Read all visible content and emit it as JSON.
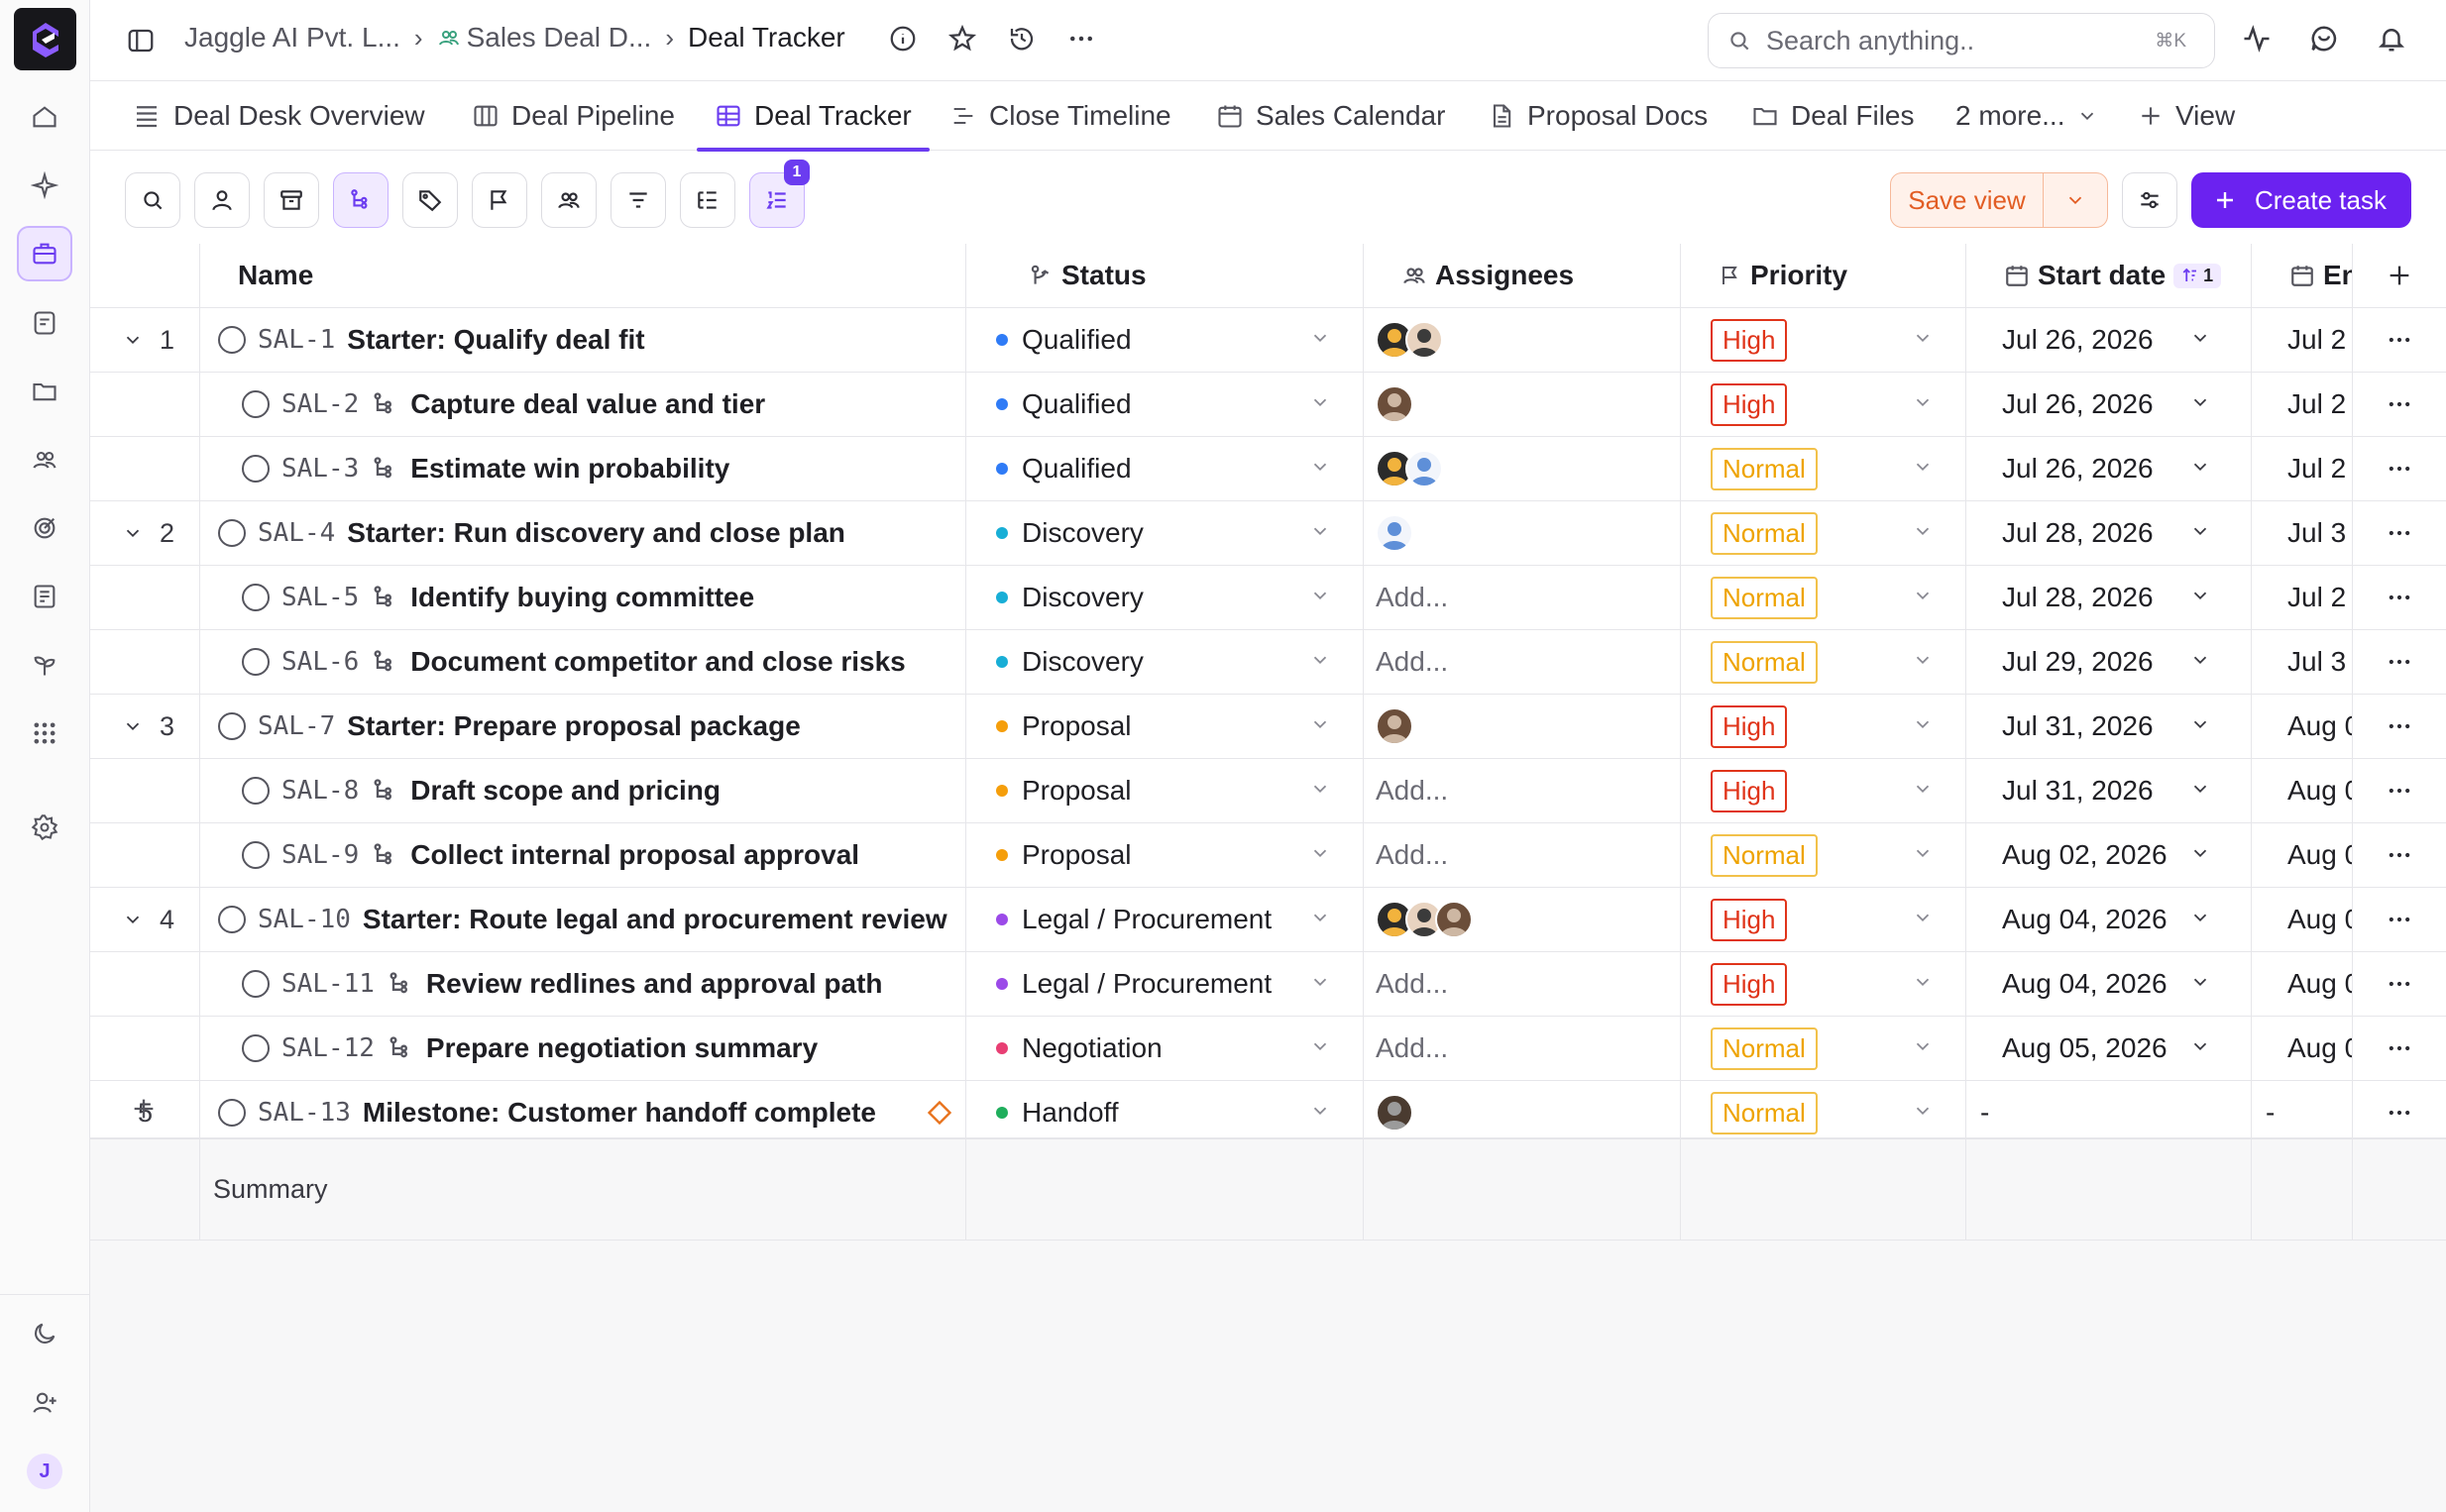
{
  "breadcrumb": {
    "workspace": "Jaggle AI Pvt. L...",
    "space": "Sales Deal D...",
    "current": "Deal Tracker"
  },
  "search": {
    "placeholder": "Search anything..",
    "shortcut": "⌘K"
  },
  "tabs": [
    {
      "label": "Deal Desk Overview",
      "icon": "list-icon"
    },
    {
      "label": "Deal Pipeline",
      "icon": "board-icon"
    },
    {
      "label": "Deal Tracker",
      "icon": "table-icon",
      "active": true
    },
    {
      "label": "Close Timeline",
      "icon": "timeline-icon"
    },
    {
      "label": "Sales Calendar",
      "icon": "calendar-icon"
    },
    {
      "label": "Proposal Docs",
      "icon": "doc-icon"
    },
    {
      "label": "Deal Files",
      "icon": "folder-icon"
    },
    {
      "label": "2 more...",
      "icon": "chevron-down-icon"
    },
    {
      "label": "View",
      "icon": "plus-icon"
    }
  ],
  "toolbar": {
    "sort_badge": "1",
    "save_view": "Save view",
    "create_task": "Create task"
  },
  "columns": {
    "name": "Name",
    "status": "Status",
    "assignees": "Assignees",
    "priority": "Priority",
    "start_date": "Start date",
    "start_sort_badge": "1",
    "end_date": "En"
  },
  "rows": [
    {
      "num": "1",
      "id": "SAL-1",
      "title": "Starter: Qualify deal fit",
      "status": "Qualified",
      "status_color": "#2f7bf6",
      "assignees": [
        "orange",
        "dark"
      ],
      "priority": "High",
      "start": "Jul 26, 2026",
      "end": "Jul 2"
    },
    {
      "num": "",
      "id": "SAL-2",
      "title": "Capture deal value and tier",
      "status": "Qualified",
      "status_color": "#2f7bf6",
      "assignees": [
        "tan"
      ],
      "priority": "High",
      "start": "Jul 26, 2026",
      "end": "Jul 2"
    },
    {
      "num": "",
      "id": "SAL-3",
      "title": "Estimate win probability",
      "status": "Qualified",
      "status_color": "#2f7bf6",
      "assignees": [
        "orange",
        "blue"
      ],
      "priority": "Normal",
      "start": "Jul 26, 2026",
      "end": "Jul 2"
    },
    {
      "num": "2",
      "id": "SAL-4",
      "title": "Starter: Run discovery and close plan",
      "status": "Discovery",
      "status_color": "#18aed6",
      "assignees": [
        "blue"
      ],
      "priority": "Normal",
      "start": "Jul 28, 2026",
      "end": "Jul 3"
    },
    {
      "num": "",
      "id": "SAL-5",
      "title": "Identify buying committee",
      "status": "Discovery",
      "status_color": "#18aed6",
      "assignees": [],
      "priority": "Normal",
      "start": "Jul 28, 2026",
      "end": "Jul 2"
    },
    {
      "num": "",
      "id": "SAL-6",
      "title": "Document competitor and close risks",
      "status": "Discovery",
      "status_color": "#18aed6",
      "assignees": [],
      "priority": "Normal",
      "start": "Jul 29, 2026",
      "end": "Jul 3"
    },
    {
      "num": "3",
      "id": "SAL-7",
      "title": "Starter: Prepare proposal package",
      "status": "Proposal",
      "status_color": "#f59e0b",
      "assignees": [
        "tan"
      ],
      "priority": "High",
      "start": "Jul 31, 2026",
      "end": "Aug 0"
    },
    {
      "num": "",
      "id": "SAL-8",
      "title": "Draft scope and pricing",
      "status": "Proposal",
      "status_color": "#f59e0b",
      "assignees": [],
      "priority": "High",
      "start": "Jul 31, 2026",
      "end": "Aug 0"
    },
    {
      "num": "",
      "id": "SAL-9",
      "title": "Collect internal proposal approval",
      "status": "Proposal",
      "status_color": "#f59e0b",
      "assignees": [],
      "priority": "Normal",
      "start": "Aug 02, 2026",
      "end": "Aug 0"
    },
    {
      "num": "4",
      "id": "SAL-10",
      "title": "Starter: Route legal and procurement review",
      "status": "Legal / Procurement",
      "status_color": "#9b4ae8",
      "assignees": [
        "orange",
        "dark",
        "tan"
      ],
      "priority": "High",
      "start": "Aug 04, 2026",
      "end": "Aug 0"
    },
    {
      "num": "",
      "id": "SAL-11",
      "title": "Review redlines and approval path",
      "status": "Legal / Procurement",
      "status_color": "#9b4ae8",
      "assignees": [],
      "priority": "High",
      "start": "Aug 04, 2026",
      "end": "Aug 0"
    },
    {
      "num": "",
      "id": "SAL-12",
      "title": "Prepare negotiation summary",
      "status": "Negotiation",
      "status_color": "#e83e73",
      "assignees": [],
      "priority": "Normal",
      "start": "Aug 05, 2026",
      "end": "Aug 0"
    },
    {
      "num": "5",
      "id": "SAL-13",
      "title": "Milestone: Customer handoff complete",
      "status": "Handoff",
      "status_color": "#1fae5c",
      "assignees": [
        "gray"
      ],
      "priority": "Normal",
      "start": "-",
      "end": "-",
      "milestone": true
    }
  ],
  "add_placeholder": "Add...",
  "summary_label": "Summary",
  "colors": {
    "accent": "#6b3cf0",
    "high": "#e0341a",
    "normal": "#eea300",
    "save_view": "#e25d24"
  }
}
